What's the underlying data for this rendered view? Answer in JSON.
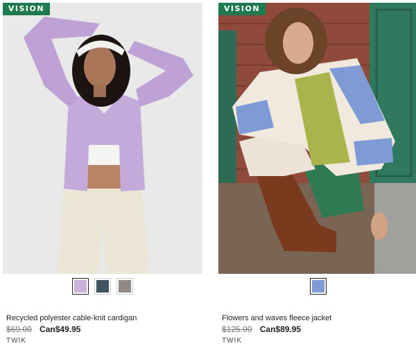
{
  "products": [
    {
      "badge": "VISION",
      "name": "Recycled polyester cable-knit cardigan",
      "old_price": "$69.00",
      "new_price": "Can$49.95",
      "brand": "TWIK",
      "swatches": [
        {
          "color": "#c9b3dc",
          "selected": true
        },
        {
          "color": "#3f5560",
          "selected": false
        },
        {
          "color": "#8f8a86",
          "selected": false
        }
      ]
    },
    {
      "badge": "VISION",
      "name": "Flowers and waves fleece jacket",
      "old_price": "$125.00",
      "new_price": "Can$89.95",
      "brand": "TWIK",
      "swatches": [
        {
          "color": "#7e9bd6",
          "selected": true
        }
      ]
    }
  ]
}
